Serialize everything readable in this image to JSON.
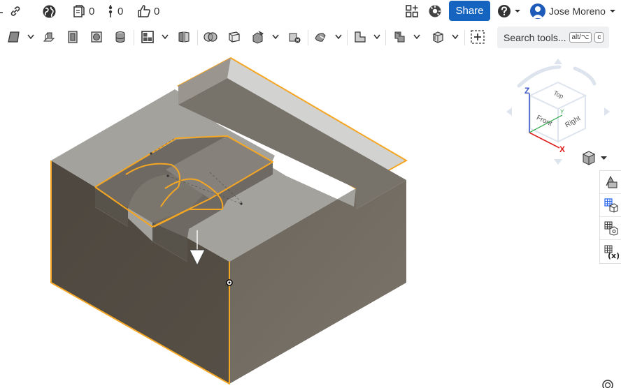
{
  "topbar": {
    "documents_count": "0",
    "versions_count": "0",
    "likes_count": "0",
    "share_label": "Share",
    "user_name": "Jose Moreno"
  },
  "search": {
    "label": "Search tools...",
    "shortcut_1": "alt/⌥",
    "shortcut_2": "c"
  },
  "viewcube": {
    "top_label": "Top",
    "front_label": "Front",
    "right_label": "Right",
    "axis_x": "X",
    "axis_y": "Y",
    "axis_z": "Z"
  },
  "icons": [
    "link-icon",
    "globe-icon",
    "documents-icon",
    "versions-icon",
    "like-icon",
    "add-app-icon",
    "app-store-icon",
    "help-icon",
    "avatar",
    "sketch-icon",
    "extrude-icon",
    "revolve-icon",
    "sweep-icon",
    "fillet-icon",
    "shell-icon",
    "boolean-icon",
    "plane-icon",
    "pattern-icon",
    "mate-icon",
    "section-icon",
    "measure-icon",
    "display-states-icon"
  ],
  "colors": {
    "accent": "#1565c0",
    "selection": "#f5a623",
    "part_dark": "#4f4a42",
    "part_mid": "#706a60"
  }
}
